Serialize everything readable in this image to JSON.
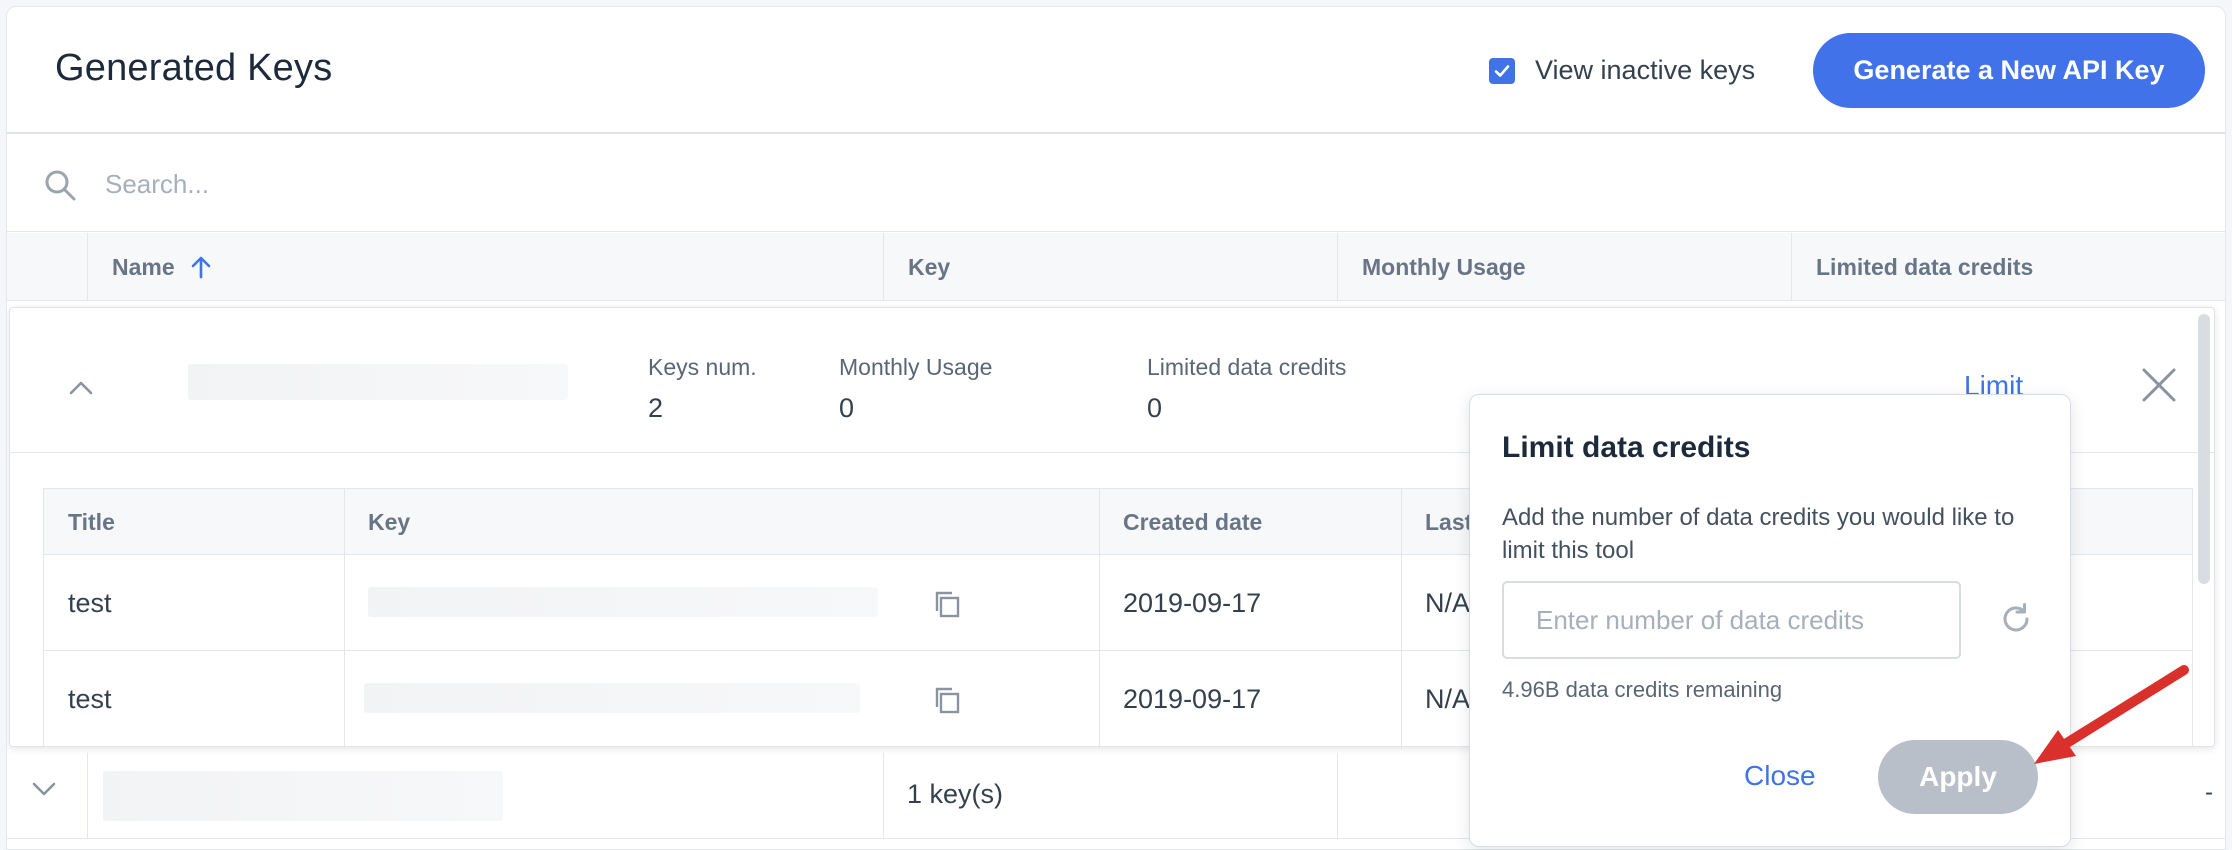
{
  "header": {
    "title": "Generated Keys",
    "view_inactive_label": "View inactive keys",
    "view_inactive_checked": true,
    "generate_button": "Generate a New API Key"
  },
  "search": {
    "placeholder": "Search..."
  },
  "table": {
    "columns": [
      "Name",
      "Key",
      "Monthly Usage",
      "Limited data credits"
    ],
    "sort_column": "Name",
    "sort_direction": "ascending"
  },
  "expanded_group": {
    "stats": [
      {
        "label": "Keys num.",
        "value": "2"
      },
      {
        "label": "Monthly Usage",
        "value": "0"
      },
      {
        "label": "Limited data credits",
        "value": "0"
      }
    ],
    "limit_link": "Limit",
    "inner_columns": [
      "Title",
      "Key",
      "Created date",
      "Last"
    ],
    "rows": [
      {
        "title": "test",
        "created": "2019-09-17",
        "last": "N/A"
      },
      {
        "title": "test",
        "created": "2019-09-17",
        "last": "N/A"
      }
    ]
  },
  "collapsed_group": {
    "key_count": "1 key(s)",
    "trailing": "-"
  },
  "popover": {
    "title": "Limit data credits",
    "description": "Add the number of data credits you would like to limit this tool",
    "input_placeholder": "Enter number of data credits",
    "remaining": "4.96B data credits remaining",
    "close_label": "Close",
    "apply_label": "Apply"
  },
  "colors": {
    "accent": "#4172ea",
    "link": "#3f73e6",
    "disabled_button": "#b9bfc8",
    "annotation_arrow": "#d9302b"
  }
}
